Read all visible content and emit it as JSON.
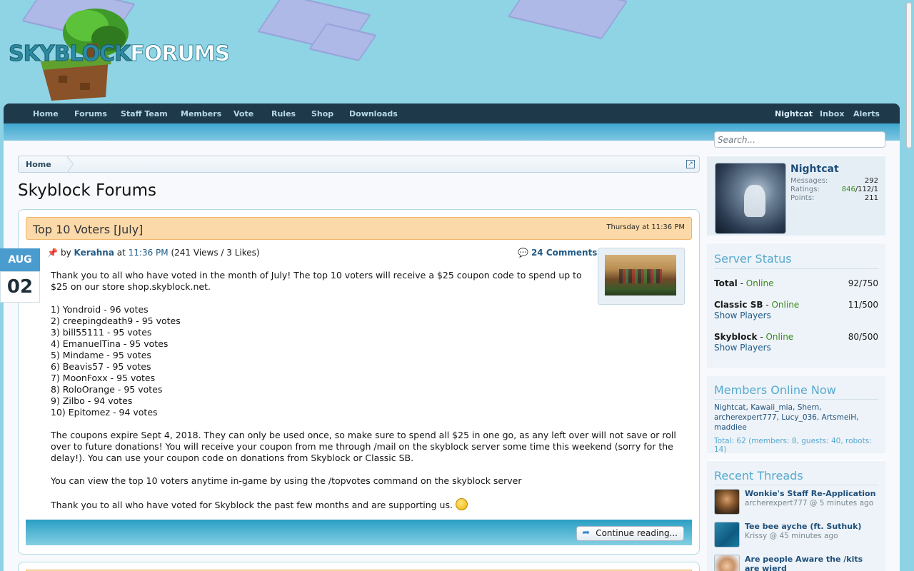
{
  "site": {
    "logo_part1": "SKYBLOCK",
    "logo_part2": "FORUMS"
  },
  "nav": {
    "items": [
      "Home",
      "Forums",
      "Staff Team",
      "Members",
      "Vote",
      "Rules",
      "Shop",
      "Downloads"
    ],
    "user": "Nightcat",
    "inbox": "Inbox",
    "alerts": "Alerts"
  },
  "search": {
    "placeholder": "Search..."
  },
  "breadcrumb": {
    "home": "Home"
  },
  "page": {
    "title": "Skyblock Forums"
  },
  "post": {
    "title": "Top 10 Voters [July]",
    "date_header": "Thursday at 11:36 PM",
    "month": "AUG",
    "day": "02",
    "by": "by",
    "author": "Kerahna",
    "at": "at",
    "time": "11:36 PM",
    "stats": "(241 Views / 3 Likes)",
    "comments": "24 Comments",
    "intro": "Thank you to all who have voted in the month of July! The top 10 voters will receive a $25 coupon code to spend up to $25 on our store shop.skyblock.net.",
    "voters": [
      "1) Yondroid - 96 votes",
      "2) creepingdeath9 - 95 votes",
      "3) bill55111 - 95 votes",
      "4) EmanuelTina - 95 votes",
      "5) Mindame - 95 votes",
      "6) Beavis57 - 95 votes",
      "7) MoonFoxx - 95 votes",
      "8) RoloOrange - 95 votes",
      "9) Zilbo - 94 votes",
      "10) Epitomez - 94 votes"
    ],
    "coupons": "The coupons expire Sept 4, 2018. They can only be used once, so make sure to spend all $25 in one go, as any left over will not save or roll over to future donations! You will receive your coupon from me through /mail on the skyblock server some time this weekend (sorry for the delay!). You can use your coupon code on donations from Skyblock or Classic SB.",
    "topvotes": "You can view the top 10 voters anytime in-game by using the /topvotes command on the skyblock server",
    "thanks": "Thank you to all who have voted for Skyblock the past few months and are supporting us.",
    "continue": "Continue reading..."
  },
  "visitor": {
    "name": "Nightcat",
    "messages_label": "Messages:",
    "messages": "292",
    "ratings_label": "Ratings:",
    "ratings_pos": "846",
    "ratings_rest": "/112/1",
    "points_label": "Points:",
    "points": "211"
  },
  "server_status": {
    "heading": "Server Status",
    "servers": [
      {
        "name": "Total",
        "sep": " - ",
        "status": "Online",
        "count": "92/750",
        "show": ""
      },
      {
        "name": "Classic SB",
        "sep": " - ",
        "status": "Online",
        "count": "11/500",
        "show": "Show Players"
      },
      {
        "name": "Skyblock",
        "sep": " - ",
        "status": "Online",
        "count": "80/500",
        "show": "Show Players"
      }
    ]
  },
  "members_online": {
    "heading": "Members Online Now",
    "list": "Nightcat, Kawaii_mia, Shern, archerexpert777, Lucy_036, ArtsmeiH, maddiee",
    "total": "Total: 62 (members: 8, guests: 40, robots: 14)"
  },
  "recent_threads": {
    "heading": "Recent Threads",
    "items": [
      {
        "title": "Wonkie's Staff Re-Application",
        "sub": "archerexpert777 @ 5 minutes ago"
      },
      {
        "title": "Tee bee ayche (ft. Suthuk)",
        "sub": "Krissy @ 45 minutes ago"
      },
      {
        "title": "Are people Aware the /kits are wierd",
        "sub": ""
      }
    ]
  },
  "colors": {
    "header_bg": "#8fd4e5",
    "nav_bg": "#1e3a4a",
    "title_bar": "#fbd9a8",
    "link": "#1f5a86",
    "online": "#3a8a1a",
    "sidebar_heading": "#56a9cf"
  }
}
